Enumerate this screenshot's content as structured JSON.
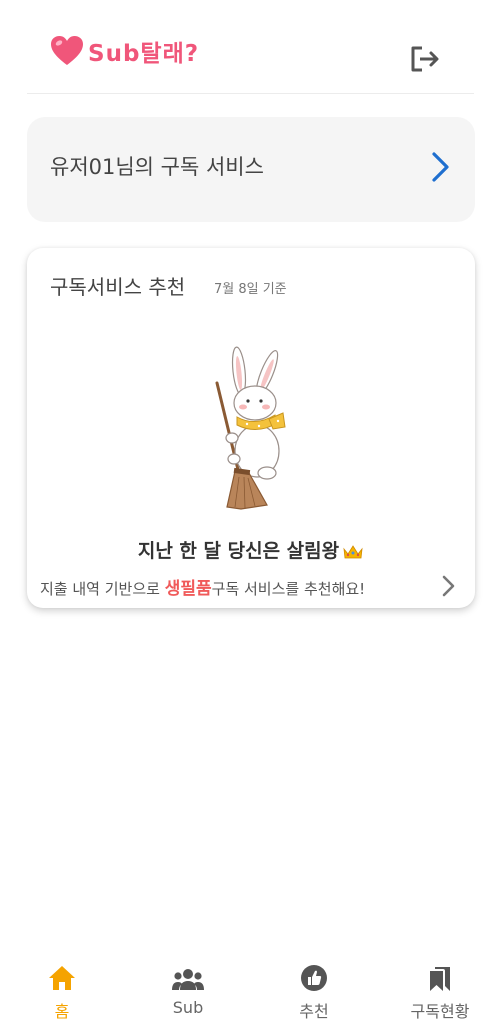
{
  "header": {
    "logo_text": "Sub탈래?"
  },
  "subscription_card": {
    "label": "유저01님의 구독 서비스"
  },
  "recommendation": {
    "title": "구독서비스 추천",
    "date": "7월 8일 기준",
    "headline": "지난 한 달 당신은 살림왕",
    "desc_prefix": "지출 내역 기반으로 ",
    "desc_highlight": "생필품",
    "desc_suffix": "구독 서비스를 추천해요!"
  },
  "bottom_nav": {
    "items": [
      {
        "label": "홈",
        "icon": "home-icon",
        "active": true
      },
      {
        "label": "Sub",
        "icon": "group-icon",
        "active": false
      },
      {
        "label": "추천",
        "icon": "thumbs-up-icon",
        "active": false
      },
      {
        "label": "구독현황",
        "icon": "bookmarks-icon",
        "active": false
      }
    ]
  },
  "colors": {
    "brand_pink": "#f0567a",
    "accent_blue": "#1f6fcf",
    "active_orange": "#f5a300",
    "highlight_red": "#f05a5a"
  }
}
